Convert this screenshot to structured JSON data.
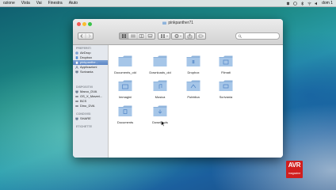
{
  "menubar": {
    "items": [
      "Vista",
      "Vai",
      "Finestra",
      "Aiuto"
    ],
    "clipped_first": "ozione",
    "clock": "dom 1"
  },
  "window": {
    "title": "pinkpanther71",
    "toolbar_icons": [
      "back-icon",
      "forward-icon",
      "icon-view-icon",
      "list-view-icon",
      "column-view-icon",
      "cover-flow-icon",
      "arrange-icon",
      "action-icon",
      "share-icon",
      "tag-icon"
    ]
  },
  "sidebar": {
    "sections": [
      {
        "title": "PREFERITI",
        "items": [
          {
            "label": "AirDrop",
            "icon": "airdrop-icon",
            "selected": false
          },
          {
            "label": "Dropbox",
            "icon": "dropbox-icon",
            "selected": false
          },
          {
            "label": "pinkpanthe...",
            "icon": "home-icon",
            "selected": true
          },
          {
            "label": "Applicazioni",
            "icon": "applications-icon",
            "selected": false
          },
          {
            "label": "Scrivania",
            "icon": "desktop-icon",
            "selected": false
          }
        ]
      },
      {
        "title": "DISPOSITIVI",
        "items": [
          {
            "label": "Marco_DVA",
            "icon": "computer-icon",
            "selected": false
          },
          {
            "label": "OS_X_Maveri...",
            "icon": "disk-icon",
            "selected": false
          },
          {
            "label": "BCS",
            "icon": "disk-icon",
            "selected": false
          },
          {
            "label": "Dino_DVA",
            "icon": "disk-icon",
            "selected": false
          }
        ]
      },
      {
        "title": "CONDIVISI",
        "items": [
          {
            "label": "SHARE",
            "icon": "server-icon",
            "selected": false
          }
        ]
      },
      {
        "title": "ETICHETTE",
        "items": []
      }
    ]
  },
  "folders": [
    {
      "label": "Documents_old"
    },
    {
      "label": "Downloads_old"
    },
    {
      "label": "Dropbox"
    },
    {
      "label": "Filmati"
    },
    {
      "label": "Immagini"
    },
    {
      "label": "Musica"
    },
    {
      "label": "Pubblica"
    },
    {
      "label": "Scrivania"
    },
    {
      "label": "Documents"
    },
    {
      "label": "Downloads"
    }
  ],
  "badge": {
    "main": "AVR",
    "sub": "magazine"
  },
  "colors": {
    "badge": "#d01e1e",
    "sidebar_selected": "#5c86c4",
    "folder": "#8fb4dc"
  }
}
